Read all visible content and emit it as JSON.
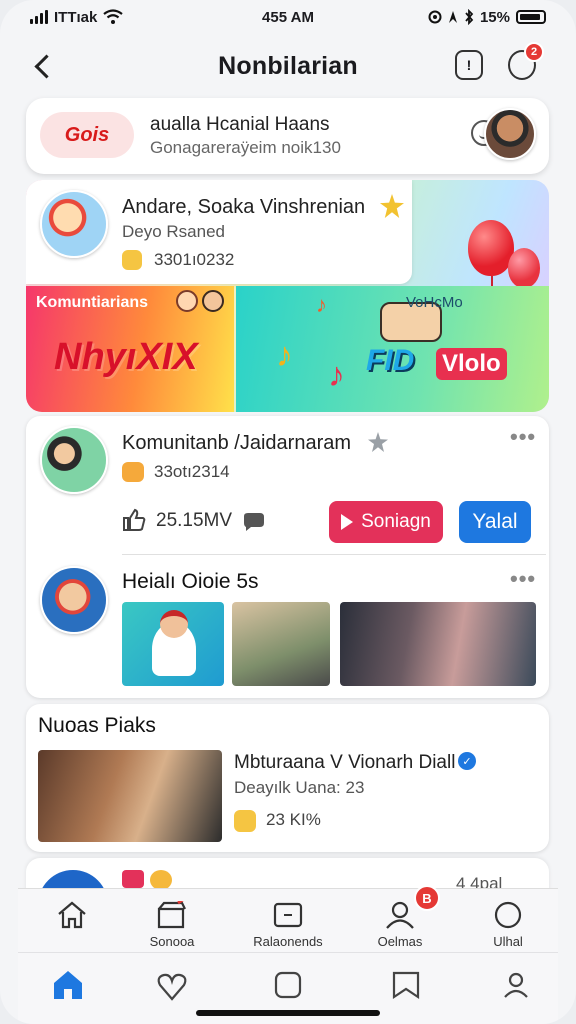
{
  "status_bar": {
    "carrier": "ITTıak",
    "time": "455 AM",
    "battery": "15%"
  },
  "header": {
    "title": "Nonbilarian",
    "notification_count": "2"
  },
  "search_card": {
    "logo_text": "Gois",
    "line1": "aualla Hcanial Haans",
    "line2": "Gonagareraÿeim noik130"
  },
  "banner": {
    "info_title": "Andare, Soaka Vinshrenian",
    "info_sub": "Deyo Rsaned",
    "info_count": "3301ı0232",
    "left_label_top": "Komuntiarians",
    "left_label_big": "NhyıXIX",
    "right_label_top": "VoHcMo",
    "right_label_big_1": "FID",
    "right_label_big_2": "Vlolo"
  },
  "feed": {
    "post1": {
      "author": "Komunitanb /Jaidarnaram",
      "count": "33otı2314",
      "likes": "25.15MV",
      "btn_red": "Soniagn",
      "btn_blue": "Yalal"
    },
    "post2": {
      "title": "Heialı Oioie 5s"
    }
  },
  "news": {
    "section_title": "Nuoas Piaks",
    "headline": "Mbturaana V Vionarh Diall",
    "sub": "Deayılk Uana: 23",
    "count": "23 KI%"
  },
  "peek": {
    "right_text": "4 4pal"
  },
  "tabs": [
    {
      "label": "Sonooa"
    },
    {
      "label": "Ralaonends"
    },
    {
      "label": "Oelmas"
    },
    {
      "label": "Ulhal"
    }
  ],
  "tab_badge": "B",
  "colors": {
    "accent_red": "#e3315a",
    "accent_blue": "#1e78e0",
    "nav_active": "#1e78e0"
  }
}
